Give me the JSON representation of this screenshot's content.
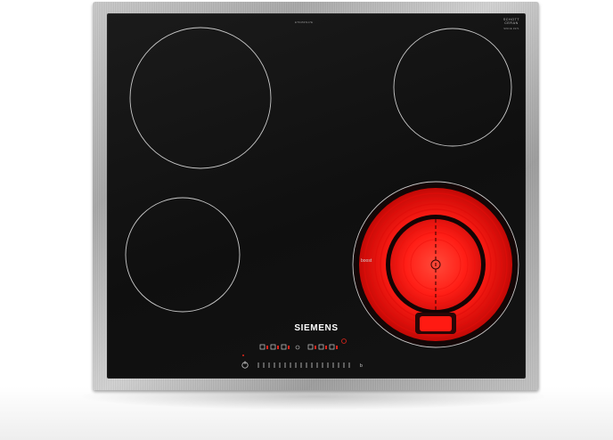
{
  "product": {
    "brand": "SIEMENS",
    "model_code": "ET645FN17E",
    "glass_logo_line1": "SCHOTT",
    "glass_logo_line2": "CERAN",
    "glass_logo_sub": "SINCE 1971"
  },
  "zones": {
    "active_zone_label": "boost",
    "active_zone_color": "#ff1a1a",
    "zone_outline_color": "#c9c9c9"
  },
  "controls": {
    "power_icon": "power-icon",
    "timer_icon": "timer-icon",
    "slider_scale": "touch-slider",
    "indicator_color": "#e0261b"
  }
}
